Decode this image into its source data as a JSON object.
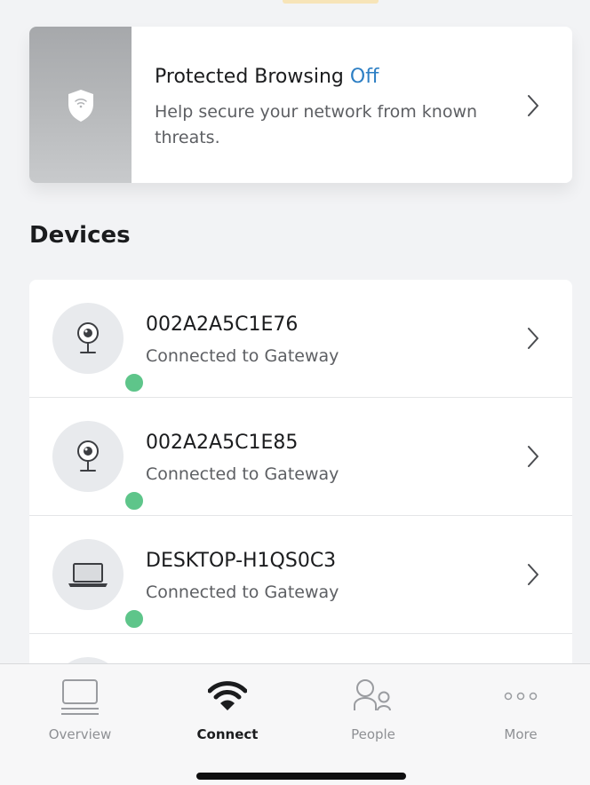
{
  "security": {
    "title": "Protected Browsing",
    "status": "Off",
    "description": "Help secure your network from known threats.",
    "icon": "shield-wifi-icon",
    "status_color": "#2d7fc4"
  },
  "devices": {
    "heading": "Devices",
    "items": [
      {
        "name": "002A2A5C1E76",
        "status": "Connected to Gateway",
        "icon": "webcam-icon"
      },
      {
        "name": "002A2A5C1E85",
        "status": "Connected to Gateway",
        "icon": "webcam-icon"
      },
      {
        "name": "DESKTOP-H1QS0C3",
        "status": "Connected to Gateway",
        "icon": "laptop-icon"
      }
    ],
    "online_color": "#5ec58a"
  },
  "tabs": [
    {
      "label": "Overview",
      "icon": "overview-icon",
      "active": false
    },
    {
      "label": "Connect",
      "icon": "wifi-icon",
      "active": true
    },
    {
      "label": "People",
      "icon": "people-icon",
      "active": false
    },
    {
      "label": "More",
      "icon": "more-icon",
      "active": false
    }
  ]
}
